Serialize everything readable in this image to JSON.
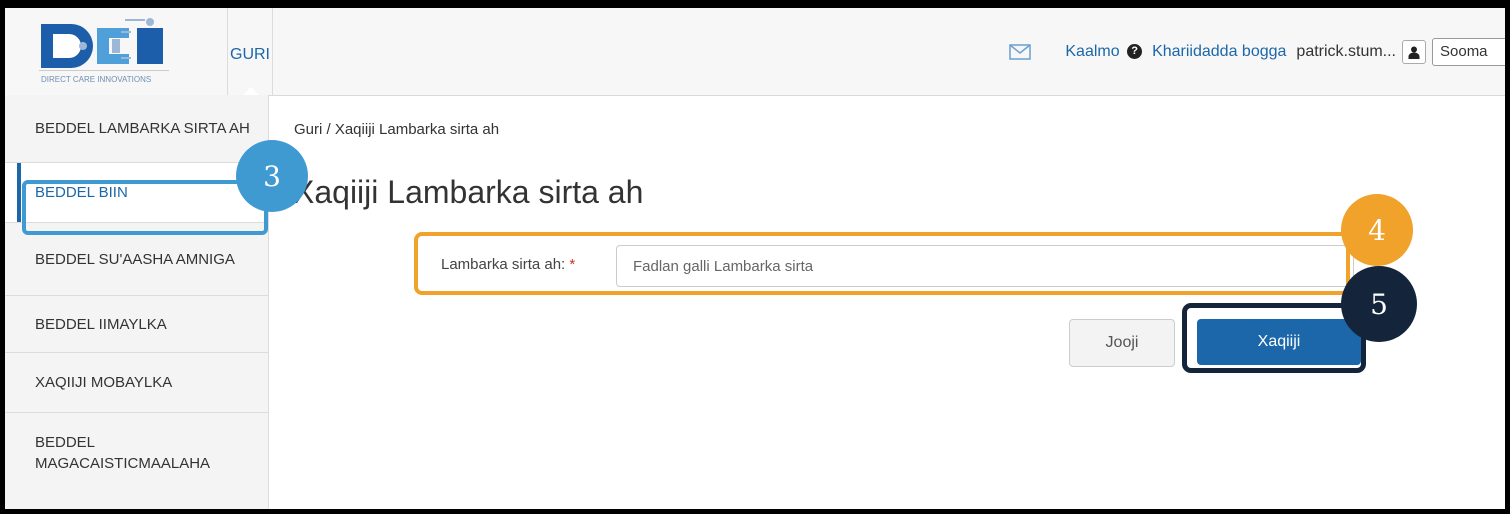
{
  "header": {
    "logo_text": "DCI",
    "logo_tagline": "DIRECT CARE INNOVATIONS",
    "nav_home": "GURI",
    "mail_icon": "envelope-icon",
    "help_label": "Kaalmo",
    "help_icon_glyph": "?",
    "site_map_label": "Khariidadda bogga",
    "username": "patrick.stum...",
    "user_icon": "user-icon",
    "language_value": "Sooma"
  },
  "sidebar": {
    "items": [
      {
        "label": "BEDDEL LAMBARKA SIRTA AH",
        "active": false
      },
      {
        "label": "BEDDEL BIIN",
        "active": true
      },
      {
        "label": "BEDDEL SU'AASHA AMNIGA",
        "active": false
      },
      {
        "label": "BEDDEL IIMAYLKA",
        "active": false
      },
      {
        "label": "XAQIIJI MOBAYLKA",
        "active": false
      },
      {
        "label": "BEDDEL MAGACAISTICMAALAHA",
        "active": false
      }
    ]
  },
  "main": {
    "breadcrumb": "Guri / Xaqiiji Lambarka sirta ah",
    "title": "Xaqiiji Lambarka sirta ah",
    "field_label": "Lambarka sirta ah:",
    "required_mark": "*",
    "field_placeholder": "Fadlan galli Lambarka sirta",
    "field_value": "",
    "cancel_label": "Jooji",
    "confirm_label": "Xaqiiji"
  },
  "annotations": {
    "step_sidebar": "3",
    "step_field": "4",
    "step_button": "5",
    "colors": {
      "blue": "#3f9ad1",
      "orange": "#f0a22b",
      "navy": "#14253b"
    }
  },
  "colors": {
    "brand": "#1b67a9",
    "required": "#c9302c"
  }
}
